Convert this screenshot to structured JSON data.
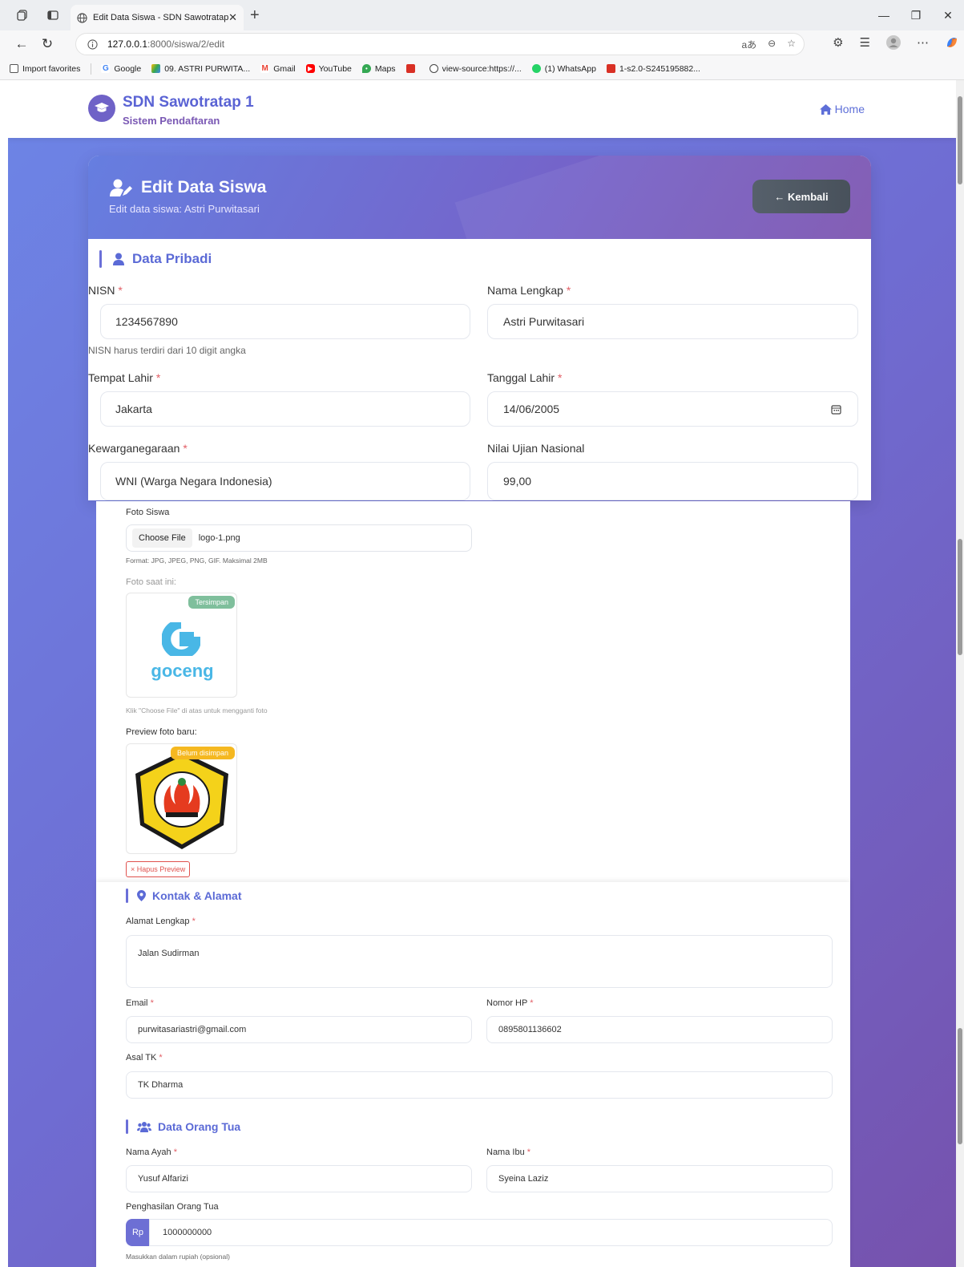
{
  "browser": {
    "tab_title": "Edit Data Siswa - SDN Sawotratap",
    "url_host": "127.0.0.1",
    "url_path": ":8000/siswa/2/edit",
    "reader_text": "aあ",
    "bookmarks": [
      "Import favorites",
      "Google",
      "09. ASTRI PURWITA...",
      "Gmail",
      "YouTube",
      "Maps",
      "view-source:https://...",
      "(1) WhatsApp",
      "1-s2.0-S245195882..."
    ]
  },
  "navbar": {
    "brand_title": "SDN Sawotratap 1",
    "brand_subtitle": "Sistem Pendaftaran",
    "home_label": "Home"
  },
  "card": {
    "title": "Edit Data Siswa",
    "subtitle": "Edit data siswa: Astri Purwitasari",
    "back_label": "← Kembali"
  },
  "pribadi": {
    "section_title": "Data Pribadi",
    "nisn_label": "NISN",
    "nisn_value": "1234567890",
    "nisn_help": "NISN harus terdiri dari 10 digit angka",
    "nama_label": "Nama Lengkap",
    "nama_value": "Astri Purwitasari",
    "tempat_label": "Tempat Lahir",
    "tempat_value": "Jakarta",
    "tanggal_label": "Tanggal Lahir",
    "tanggal_value": "14/06/2005",
    "kewarga_label": "Kewarganegaraan",
    "kewarga_value": "WNI (Warga Negara Indonesia)",
    "nilai_label": "Nilai Ujian Nasional",
    "nilai_value": "99,00"
  },
  "foto": {
    "label": "Foto Siswa",
    "choose_label": "Choose File",
    "file_name": "logo-1.png",
    "format_help": "Format: JPG, JPEG, PNG, GIF. Maksimal 2MB",
    "current_label": "Foto saat ini:",
    "saved_badge": "Tersimpan",
    "current_logo_text": "goceng",
    "replace_help": "Klik \"Choose File\" di atas untuk mengganti foto",
    "preview_label": "Preview foto baru:",
    "unsaved_badge": "Belum disimpan",
    "remove_label": "× Hapus Preview"
  },
  "kontak": {
    "section_title": "Kontak & Alamat",
    "alamat_label": "Alamat Lengkap",
    "alamat_value": "Jalan Sudirman",
    "email_label": "Email",
    "email_value": "purwitasariastri@gmail.com",
    "hp_label": "Nomor HP",
    "hp_value": "0895801136602",
    "tk_label": "Asal TK",
    "tk_value": "TK Dharma"
  },
  "ortu": {
    "section_title": "Data Orang Tua",
    "ayah_label": "Nama Ayah",
    "ayah_value": "Yusuf Alfarizi",
    "ibu_label": "Nama Ibu",
    "ibu_value": "Syeina Laziz",
    "penghasilan_label": "Penghasilan Orang Tua",
    "currency": "Rp",
    "penghasilan_value": "1000000000",
    "penghasilan_help": "Masukkan dalam rupiah (opsional)"
  },
  "required_mark": "*",
  "colors": {
    "accent": "#5b6ad6",
    "gradient_start": "#6d85e6",
    "gradient_end": "#7652ad",
    "required": "#e25e65",
    "saved_badge": "#7fbf9c",
    "unsaved_badge": "#f5b820"
  },
  "icons": [
    "tab-actions-icon",
    "workspaces-icon",
    "globe-icon",
    "back-arrow-icon",
    "refresh-icon",
    "info-icon",
    "star-icon",
    "extensions-icon",
    "favorites-icon",
    "profile-icon",
    "more-icon",
    "copilot-icon",
    "graduation-cap-icon",
    "home-icon",
    "user-edit-icon",
    "user-icon",
    "calendar-icon",
    "map-marker-icon",
    "users-icon"
  ]
}
